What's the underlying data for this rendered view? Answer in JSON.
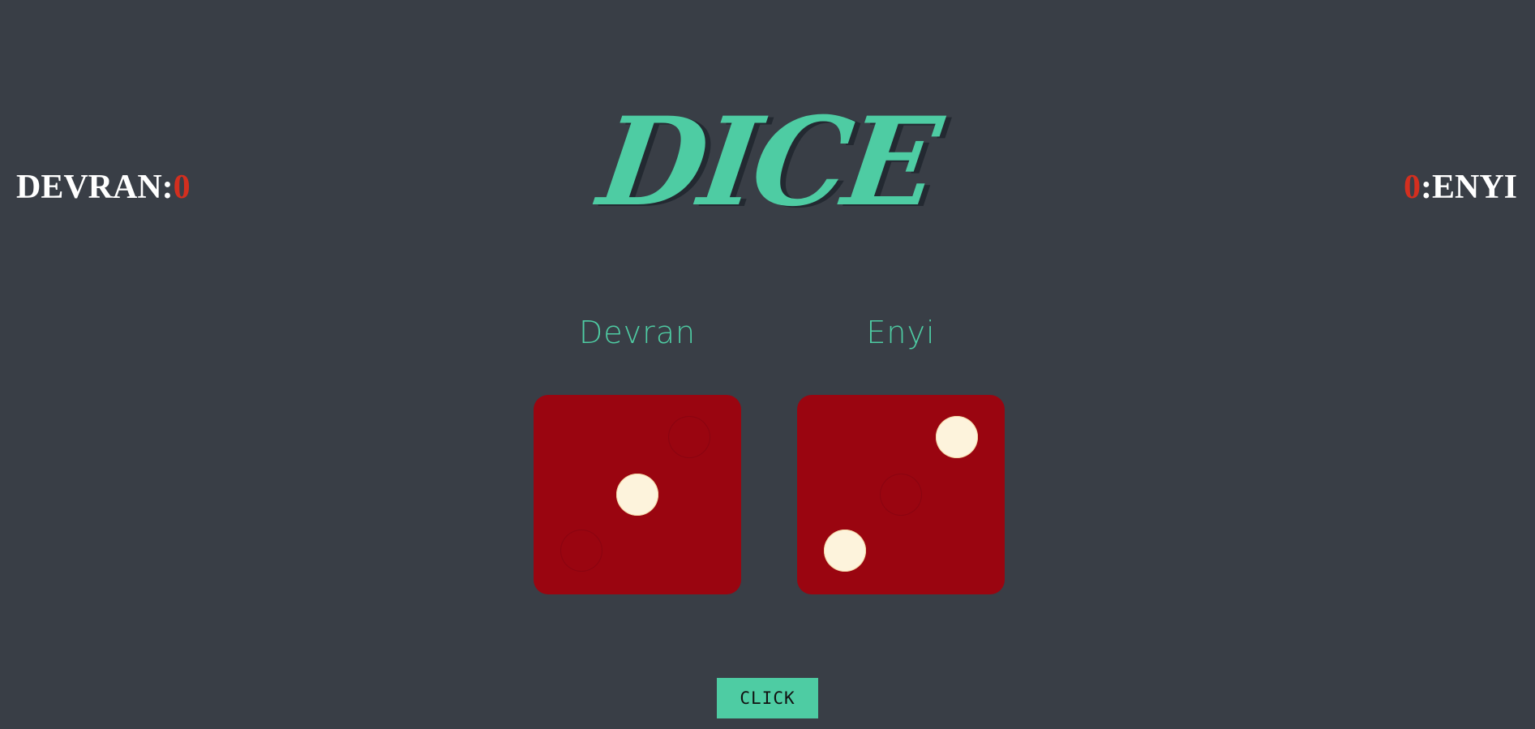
{
  "title": "DICE",
  "scores": {
    "left": {
      "label": "DEVRAN:",
      "value": "0"
    },
    "right": {
      "label": ":ENYI",
      "value": "0"
    }
  },
  "players": [
    {
      "name": "Devran",
      "die_value": 1
    },
    {
      "name": "Enyi",
      "die_value": 2
    }
  ],
  "button": {
    "label": "CLICK"
  },
  "colors": {
    "background": "#393e46",
    "accent": "#4ecca3",
    "score_value": "#d32f1f",
    "die_face": "#9a0510",
    "pip": "#fdf3dc"
  }
}
